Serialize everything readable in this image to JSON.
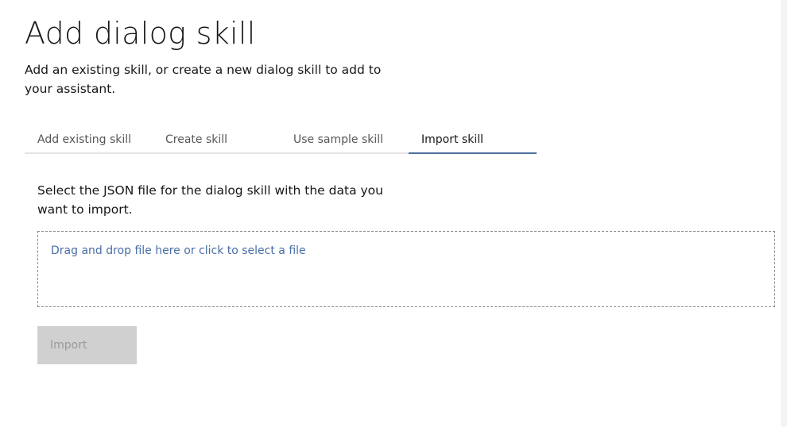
{
  "dialog": {
    "title": "Add dialog skill",
    "subtitle": "Add an existing skill, or create a new dialog skill to add to your assistant."
  },
  "tabs": [
    {
      "label": "Add existing skill",
      "active": false
    },
    {
      "label": "Create skill",
      "active": false
    },
    {
      "label": "Use sample skill",
      "active": false
    },
    {
      "label": "Import skill",
      "active": true
    }
  ],
  "import_panel": {
    "instructions": "Select the JSON file for the dialog skill with the data you want to import.",
    "dropzone_text": "Drag and drop file here or click to select a file",
    "import_button_label": "Import"
  },
  "colors": {
    "accent": "#4f6fa0",
    "link": "#4a6ea6",
    "disabled_button_bg": "#d0d0d0",
    "disabled_button_text": "#9a9a9a"
  }
}
